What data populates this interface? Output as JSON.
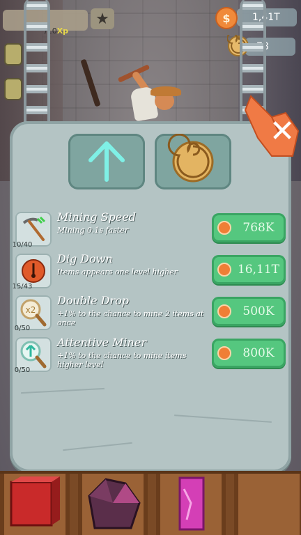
{
  "hud": {
    "xp_text": "/10",
    "xp_suffix": "Xp",
    "coins": "1,41T",
    "shells": "78"
  },
  "tabs": [
    {
      "name": "upgrades",
      "icon": "up-arrow-icon"
    },
    {
      "name": "fossils",
      "icon": "ammonite-shell-icon"
    }
  ],
  "upgrades": [
    {
      "title": "Mining Speed",
      "description": "Mining 0.1s faster",
      "level": "10/40",
      "price": "768K",
      "icon": "pickaxe-icon"
    },
    {
      "title": "Dig Down",
      "description": "Items appears one level higher",
      "level": "15/43",
      "price": "16,11T",
      "icon": "compass-dig-icon"
    },
    {
      "title": "Double Drop",
      "description": "+1% to the chance to mine 2 items at once",
      "level": "0/50",
      "price": "500K",
      "icon": "x2-magnifier-icon"
    },
    {
      "title": "Attentive Miner",
      "description": "+1% to the chance to mine items higher level",
      "level": "0/50",
      "price": "800K",
      "icon": "up-arrow-magnifier-icon"
    }
  ],
  "colors": {
    "board": "#b4c4c4",
    "buy_button": "#55c77f",
    "coin": "#ef7f36",
    "tab": "#7fa5a0"
  }
}
